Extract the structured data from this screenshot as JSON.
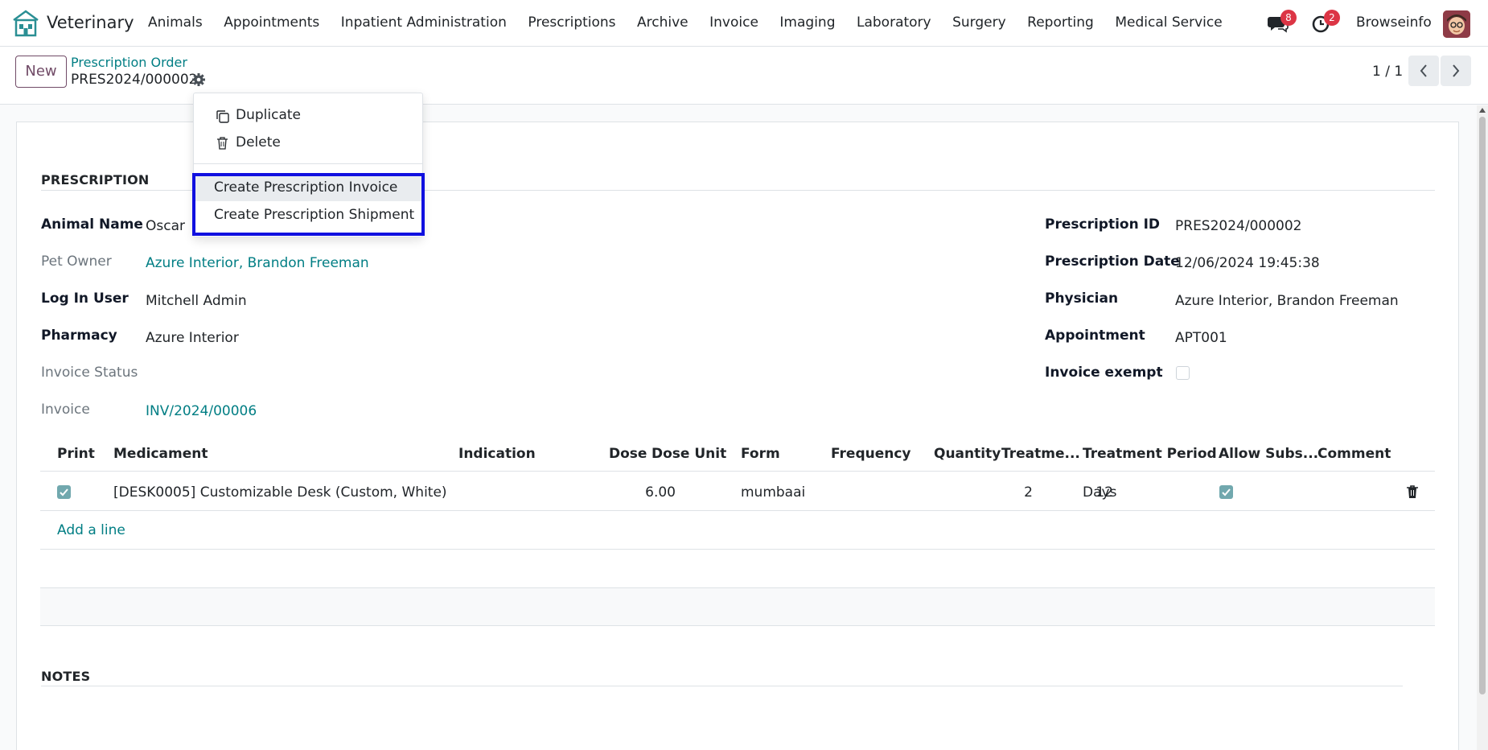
{
  "nav": {
    "app_name": "Veterinary",
    "menu": [
      "Animals",
      "Appointments",
      "Inpatient Administration",
      "Prescriptions",
      "Archive",
      "Invoice",
      "Imaging",
      "Laboratory",
      "Surgery",
      "Reporting",
      "Medical Service"
    ],
    "messages_count": "8",
    "activities_count": "2",
    "company": "Browseinfo"
  },
  "control": {
    "new_label": "New",
    "breadcrumb_parent": "Prescription Order",
    "breadcrumb_current": "PRES2024/000002",
    "pager": "1 / 1"
  },
  "dropdown": {
    "duplicate": "Duplicate",
    "delete": "Delete",
    "create_invoice": "Create Prescription Invoice",
    "create_shipment": "Create Prescription Shipment"
  },
  "prescription": {
    "section_title": "PRESCRIPTION",
    "animal_name_label": "Animal Name",
    "animal_name": "Oscar",
    "pet_owner_label": "Pet Owner",
    "pet_owner": "Azure Interior, Brandon Freeman",
    "log_in_user_label": "Log In User",
    "log_in_user": "Mitchell Admin",
    "pharmacy_label": "Pharmacy",
    "pharmacy": "Azure Interior",
    "invoice_status_label": "Invoice Status",
    "invoice_status": "",
    "invoice_label": "Invoice",
    "invoice": "INV/2024/00006",
    "prescription_id_label": "Prescription ID",
    "prescription_id": "PRES2024/000002",
    "prescription_date_label": "Prescription Date",
    "prescription_date": "12/06/2024 19:45:38",
    "physician_label": "Physician",
    "physician": "Azure Interior, Brandon Freeman",
    "appointment_label": "Appointment",
    "appointment": "APT001",
    "invoice_exempt_label": "Invoice exempt",
    "invoice_exempt": false
  },
  "table": {
    "headers": {
      "print": "Print",
      "medicament": "Medicament",
      "indication": "Indication",
      "dose": "Dose",
      "dose_unit": "Dose Unit",
      "form": "Form",
      "frequency": "Frequency",
      "quantity": "Quantity",
      "treatment": "Treatme...",
      "treatment_period": "Treatment Period",
      "allow_subs": "Allow Subs...",
      "comment": "Comment"
    },
    "rows": [
      {
        "print": true,
        "medicament": "[DESK0005] Customizable Desk (Custom, White)",
        "indication": "",
        "dose": "6.00",
        "dose_unit": "",
        "form": "mumbaai",
        "frequency": "",
        "quantity": "2",
        "treatment": "12",
        "treatment_period": "Days",
        "allow_subs": true,
        "comment": ""
      }
    ],
    "add_line": "Add a line"
  },
  "notes": {
    "section_title": "NOTES"
  },
  "colors": {
    "brand": "#714b67",
    "link": "#017e84",
    "highlight": "#1010e0",
    "badge": "#dc3545"
  }
}
